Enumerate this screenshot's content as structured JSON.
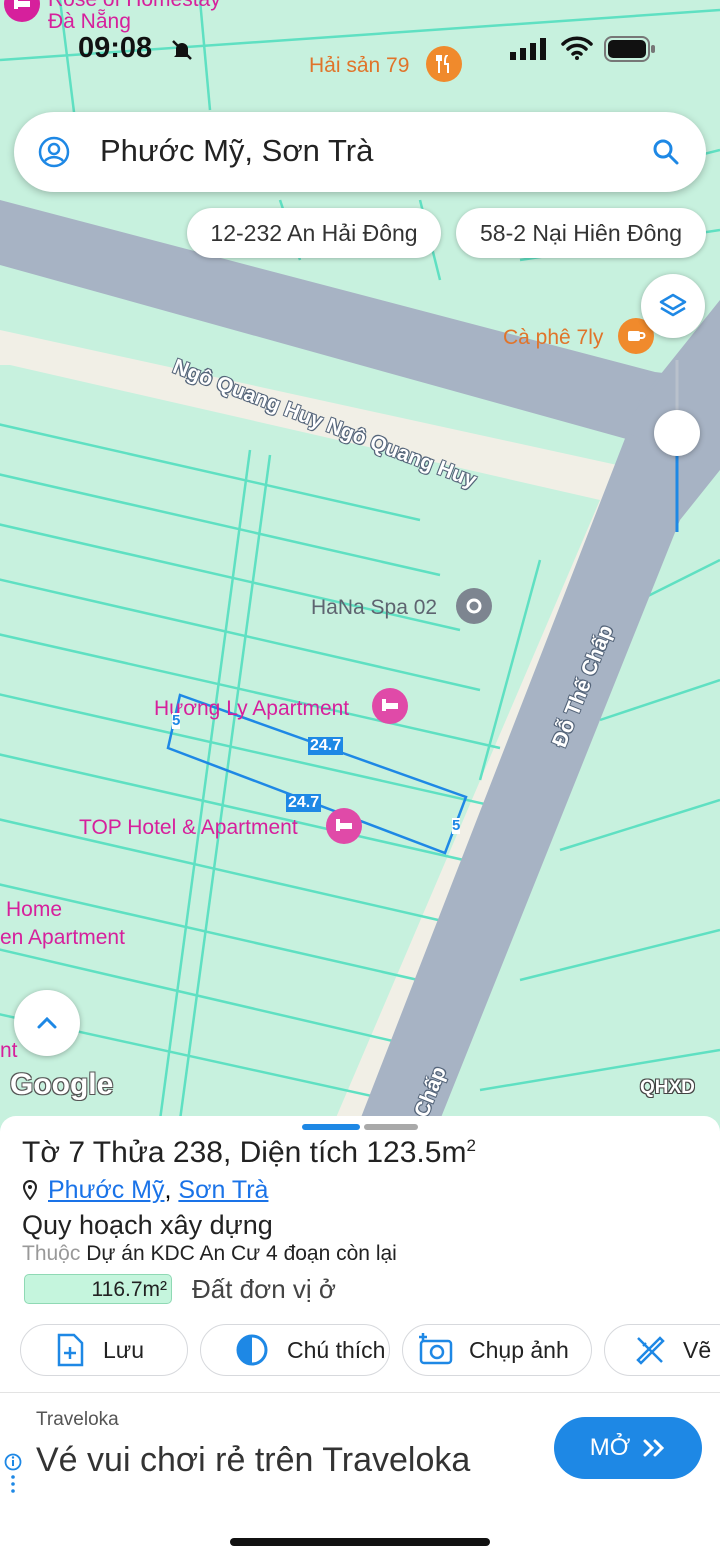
{
  "status_bar": {
    "time": "09:08"
  },
  "search": {
    "query": "Phước Mỹ, Sơn Trà"
  },
  "chips": [
    "12-232 An Hải Đông",
    "58-2 Nại Hiên Đông"
  ],
  "map": {
    "pois": {
      "top_left_line1": "Rose of Homestay",
      "top_left_line2": "Đà Nẵng",
      "hai_san": "Hải sản 79",
      "ca_phe": "Cà phê 7ly",
      "hana": "HaNa Spa 02",
      "huong_ly": "Hương Ly Apartment",
      "top_hotel": "TOP Hotel & Apartment",
      "left_home": "Home",
      "left_apartment": "en Apartment",
      "left_nt": "nt"
    },
    "roads": {
      "ngo_quang_huy": "Ngô Quang Huy Ngô Quang Huy",
      "do_the_chap": "Đỗ Thế Chấp",
      "do_the_chap_partial": "Chấp"
    },
    "parcel_dims": {
      "long_top": "24.7",
      "long_bottom": "24.7",
      "short_left": "5",
      "short_right": "5"
    },
    "google_logo": "Google",
    "layer_badge": "QHXD"
  },
  "sheet": {
    "title_prefix": "Tờ 7 Thửa 238, Diện tích 123.5m",
    "title_sup": "2",
    "ward": "Phước Mỹ",
    "separator": ", ",
    "district": "Sơn Trà",
    "plan_title": "Quy hoạch xây dựng",
    "belongs_label": "Thuộc",
    "project": "Dự án KDC An Cư 4 đoạn còn lại",
    "area_value": "116.7m²",
    "land_use": "Đất đơn vị ở",
    "actions": {
      "save": "Lưu",
      "legend": "Chú thích",
      "photo": "Chụp ảnh",
      "draw": "Vẽ"
    }
  },
  "ad": {
    "brand": "Traveloka",
    "headline": "Vé vui chơi rẻ trên Traveloka",
    "cta": "MỞ"
  },
  "colors": {
    "map_green": "#c7f1de",
    "lot_line": "#5fe0c2",
    "road": "#a7b3c4",
    "poi_pink": "#d6209c",
    "poi_orange": "#e0742a",
    "accent_blue": "#1e88e5"
  }
}
